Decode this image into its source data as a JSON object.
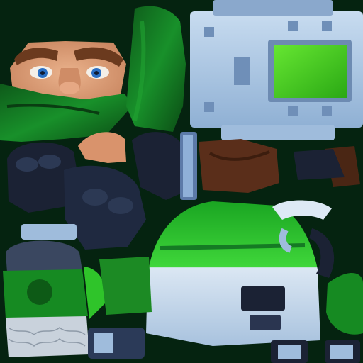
{
  "texture_atlas": {
    "colors": {
      "background": "#052310",
      "skin": "#e2a27c",
      "skin_shadow": "#b8765a",
      "hair": "#6b3a1e",
      "eye": "#2a6fc4",
      "cloak_green": "#157a24",
      "cloak_dark": "#0b4a14",
      "armor_blue": "#a9c8e8",
      "armor_light": "#dde9f5",
      "armor_dark": "#5e7fa6",
      "screen_green": "#4ad41e",
      "glove_navy": "#1b2234",
      "leather_brown": "#5a2e1a",
      "bright_green": "#2fc42a",
      "chain_grey": "#c9d2dc"
    },
    "parts": [
      {
        "name": "face",
        "icon": "face-icon"
      },
      {
        "name": "cloak",
        "icon": "cloak-icon"
      },
      {
        "name": "chest-plate",
        "icon": "armor-plate-icon"
      },
      {
        "name": "glove",
        "icon": "glove-icon"
      },
      {
        "name": "skirt",
        "icon": "skirt-icon"
      },
      {
        "name": "boot",
        "icon": "boot-icon"
      }
    ]
  }
}
